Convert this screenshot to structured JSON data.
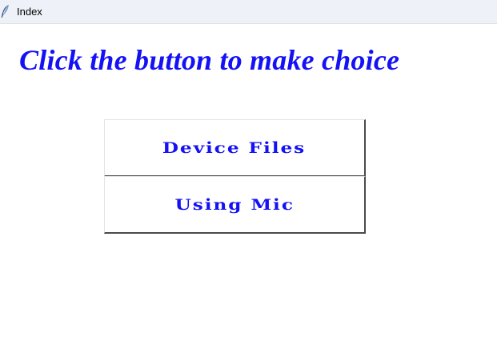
{
  "window": {
    "title": "Index",
    "icon": "feather-icon"
  },
  "main": {
    "heading": "Click the button to make choice",
    "buttons": {
      "device_files": "Device Files",
      "using_mic": "Using Mic"
    }
  },
  "colors": {
    "accent_text": "#1411f5",
    "titlebar_bg": "#eef1f7"
  }
}
